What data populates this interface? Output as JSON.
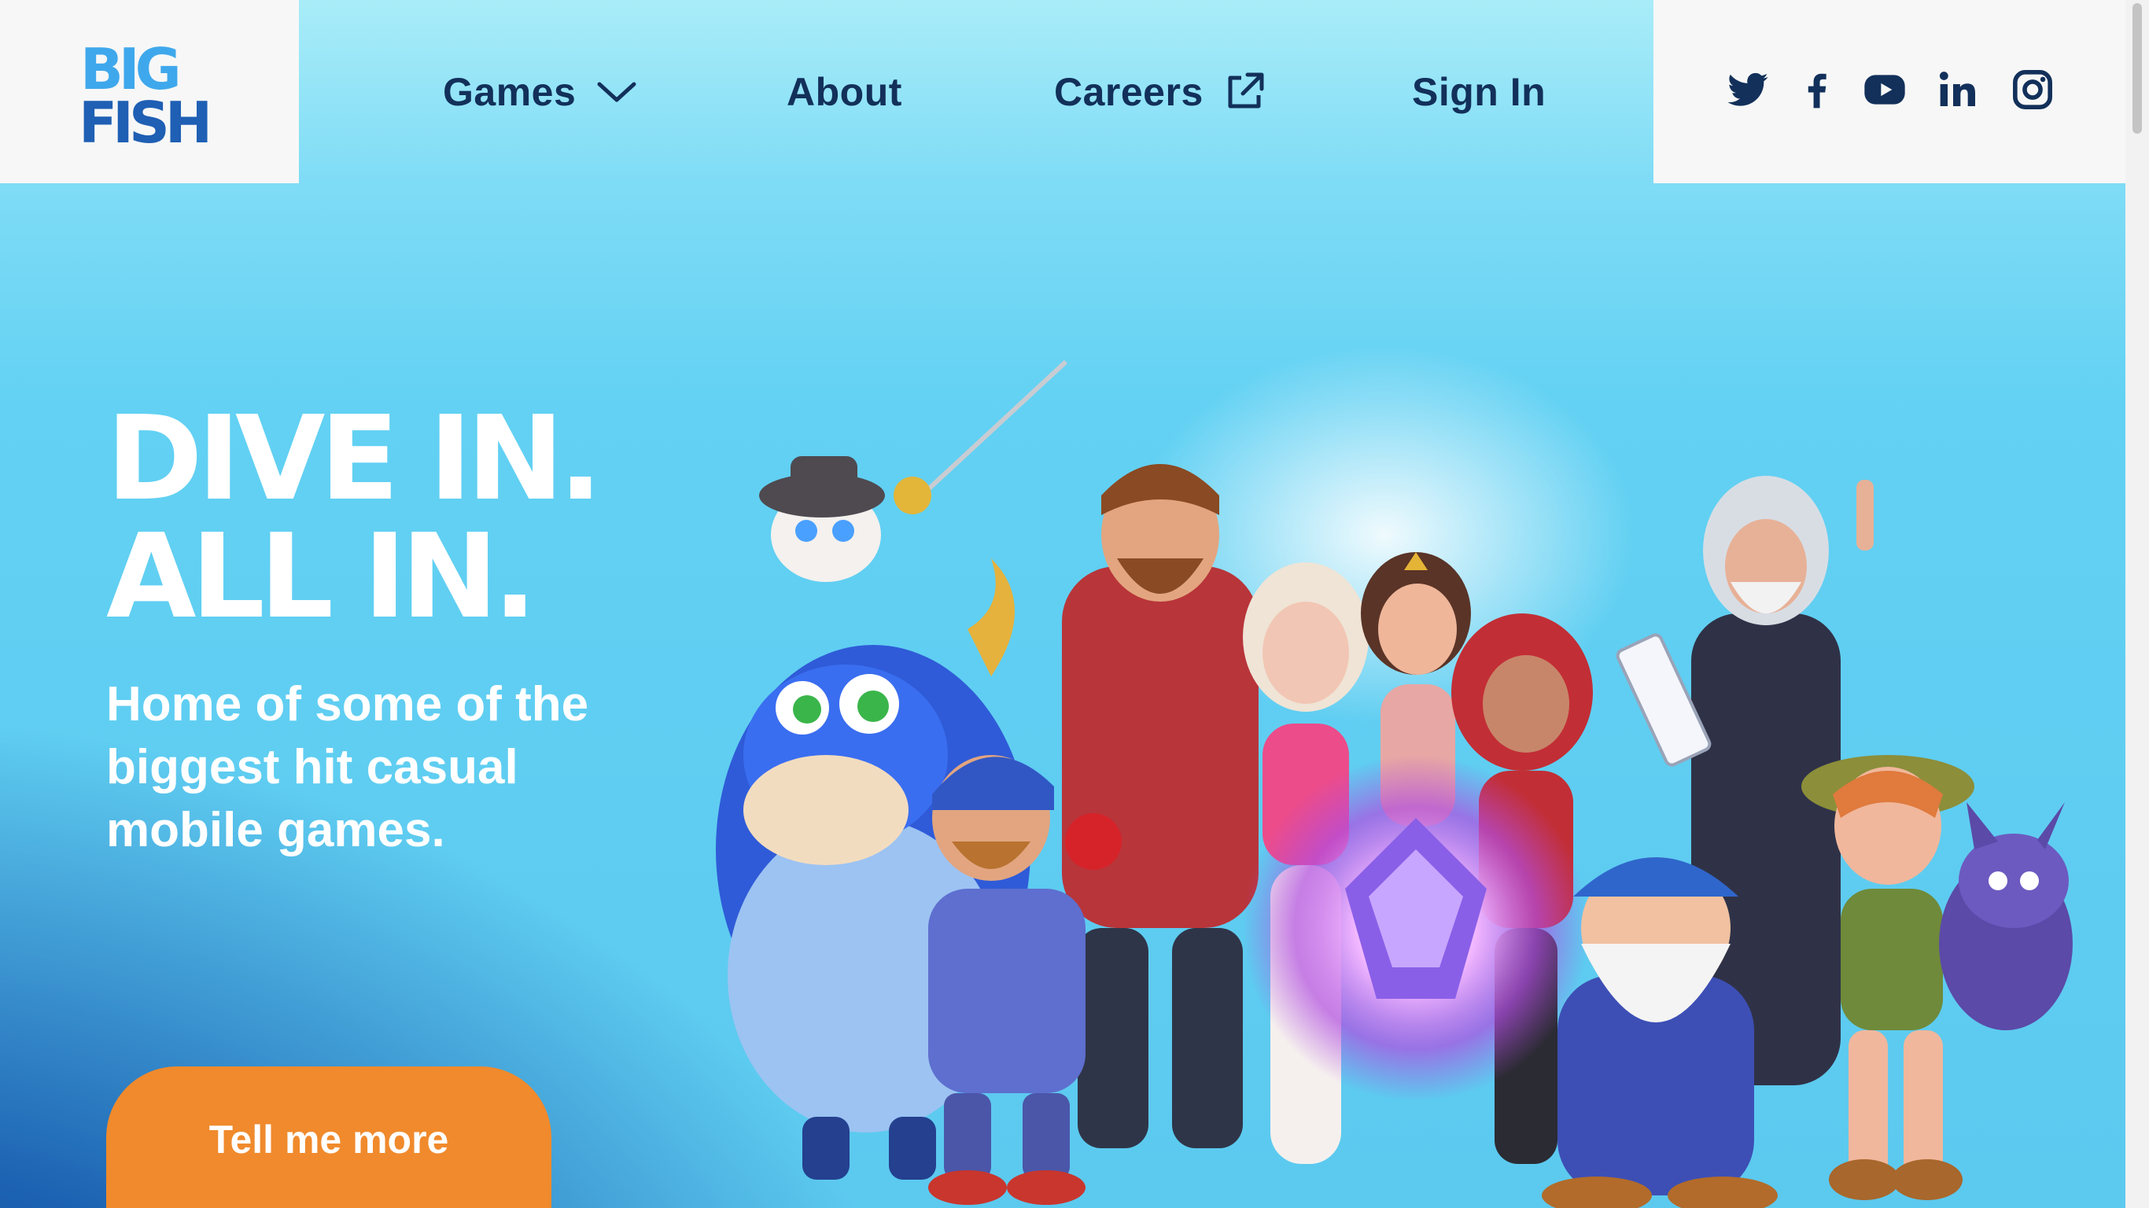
{
  "header": {
    "logo_text_top": "BIG",
    "logo_text_bottom": "FISH",
    "nav": [
      {
        "label": "Games",
        "icon": "chevron-down-icon"
      },
      {
        "label": "About"
      },
      {
        "label": "Careers",
        "icon": "external-link-icon"
      },
      {
        "label": "Sign In"
      }
    ],
    "social": [
      "twitter-icon",
      "facebook-icon",
      "youtube-icon",
      "linkedin-icon",
      "instagram-icon"
    ]
  },
  "hero": {
    "headline_line1": "DIVE IN.",
    "headline_line2": "ALL IN.",
    "subheading": "Home of some of the biggest hit casual mobile games.",
    "cta_label": "Tell me more"
  },
  "colors": {
    "nav_text": "#12305a",
    "cta": "#f08a2c",
    "logo_blue": "#2a8fe0",
    "logo_dark": "#1b4f9c"
  }
}
